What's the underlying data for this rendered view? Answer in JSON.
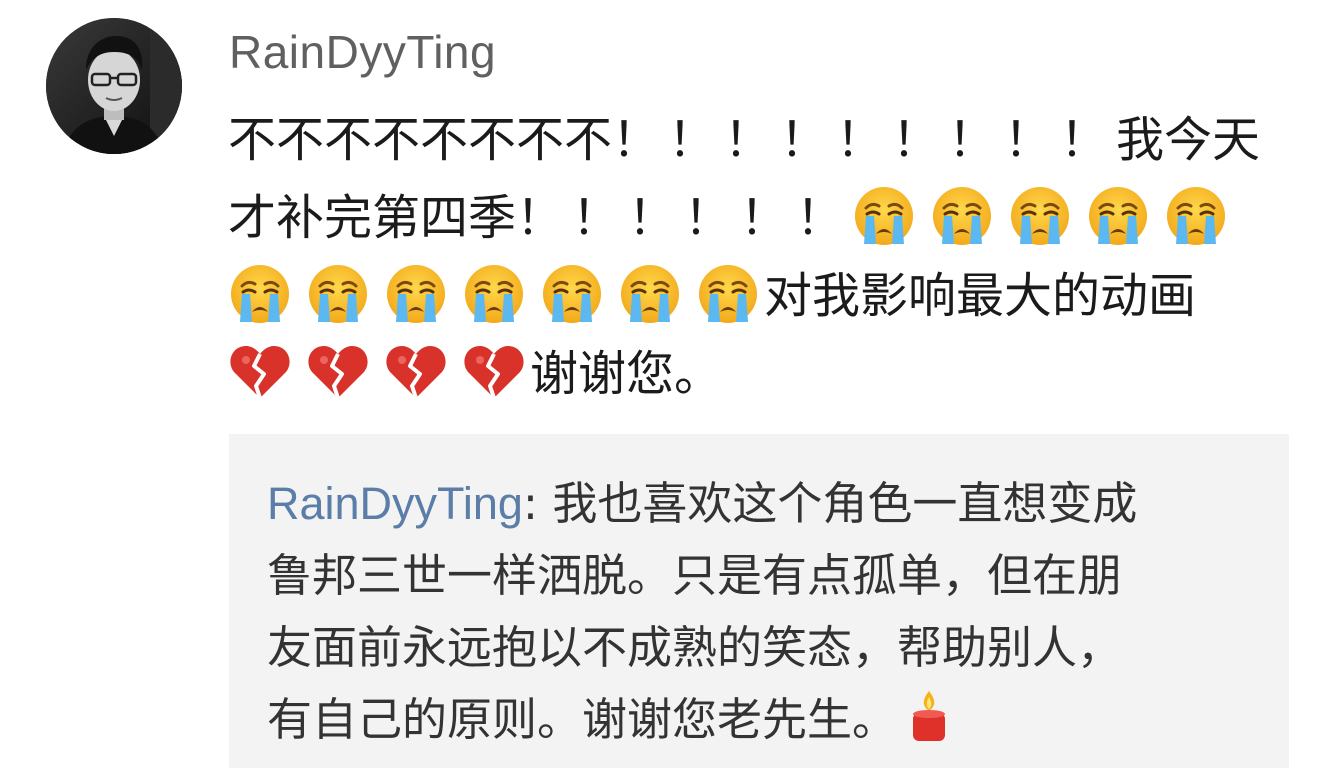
{
  "comment": {
    "username": "RainDyyTing",
    "line1_text": "不不不不不不不不",
    "line1_excl": "！！！！！！！！！",
    "line1_tail": "我今天",
    "line2_text": "才补完第四季",
    "line2_excl": "！！！！！！",
    "line3_text": "对我影响最大的动画",
    "line4_text": "谢谢您。",
    "emoji_crying": "loudly-crying-face-icon",
    "emoji_heart": "broken-heart-icon"
  },
  "reply": {
    "author": "RainDyyTing",
    "separator": ":",
    "line1": "我也喜欢这个角色一直想变成",
    "line2": "鲁邦三世一样洒脱。只是有点孤单，但在朋",
    "line3": "友面前永远抱以不成熟的笑态，帮助别人，",
    "line4": "有自己的原则。谢谢您老先生。",
    "end_icon": "candle-icon"
  },
  "colors": {
    "username": "#606060",
    "body_text": "#1b1b1b",
    "reply_author": "#5b7ea8",
    "reply_bg": "#f3f3f3",
    "reply_text": "#333333"
  }
}
